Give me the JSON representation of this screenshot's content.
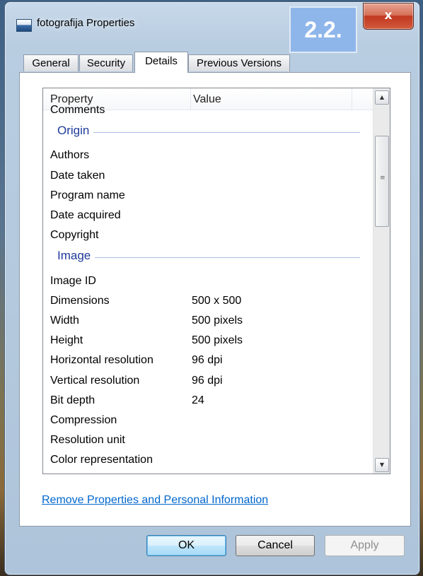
{
  "window": {
    "title": "fotografija Properties",
    "close_glyph": "x",
    "badge_label": "2.2."
  },
  "tabs": [
    {
      "label": "General",
      "active": false
    },
    {
      "label": "Security",
      "active": false
    },
    {
      "label": "Details",
      "active": true
    },
    {
      "label": "Previous Versions",
      "active": false
    }
  ],
  "details": {
    "columns": {
      "property": "Property",
      "value": "Value"
    },
    "rows": [
      {
        "type": "item",
        "property": "Comments",
        "value": ""
      },
      {
        "type": "group",
        "label": "Origin"
      },
      {
        "type": "item",
        "property": "Authors",
        "value": ""
      },
      {
        "type": "item",
        "property": "Date taken",
        "value": ""
      },
      {
        "type": "item",
        "property": "Program name",
        "value": ""
      },
      {
        "type": "item",
        "property": "Date acquired",
        "value": ""
      },
      {
        "type": "item",
        "property": "Copyright",
        "value": ""
      },
      {
        "type": "group",
        "label": "Image"
      },
      {
        "type": "item",
        "property": "Image ID",
        "value": ""
      },
      {
        "type": "item",
        "property": "Dimensions",
        "value": "500 x 500"
      },
      {
        "type": "item",
        "property": "Width",
        "value": "500 pixels"
      },
      {
        "type": "item",
        "property": "Height",
        "value": "500 pixels"
      },
      {
        "type": "item",
        "property": "Horizontal resolution",
        "value": "96 dpi"
      },
      {
        "type": "item",
        "property": "Vertical resolution",
        "value": "96 dpi"
      },
      {
        "type": "item",
        "property": "Bit depth",
        "value": "24"
      },
      {
        "type": "item",
        "property": "Compression",
        "value": ""
      },
      {
        "type": "item",
        "property": "Resolution unit",
        "value": ""
      },
      {
        "type": "item",
        "property": "Color representation",
        "value": ""
      }
    ]
  },
  "link_remove": "Remove Properties and Personal Information",
  "buttons": {
    "ok": "OK",
    "cancel": "Cancel",
    "apply": "Apply"
  },
  "colors": {
    "link": "#0066cc",
    "group_heading": "#1e3a9a",
    "badge": "#8fb6ea"
  }
}
